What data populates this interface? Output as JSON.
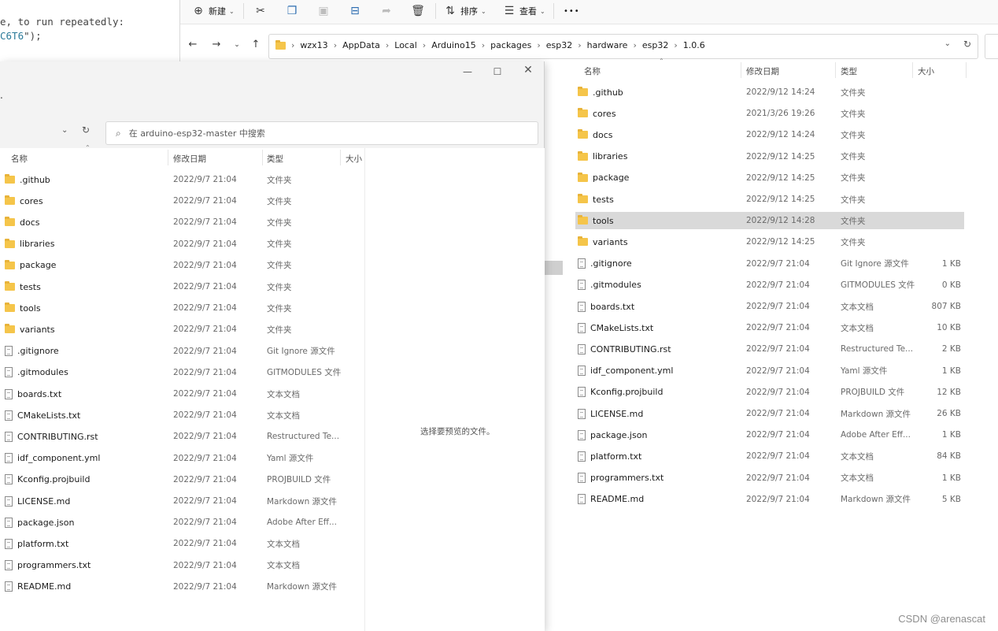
{
  "code_editor": {
    "line1": "e, to run repeatedly:",
    "line2_prefix": "C6T6",
    "line2_suffix": "\");"
  },
  "right_window": {
    "toolbar": {
      "new_label": "新建",
      "sort_label": "排序",
      "view_label": "查看",
      "more_label": "•••"
    },
    "breadcrumb": [
      "wzx13",
      "AppData",
      "Local",
      "Arduino15",
      "packages",
      "esp32",
      "hardware",
      "esp32",
      "1.0.6"
    ],
    "columns": {
      "name": "名称",
      "date": "修改日期",
      "type": "类型",
      "size": "大小"
    },
    "rows": [
      {
        "name": ".github",
        "date": "2022/9/12 14:24",
        "type": "文件夹",
        "size": "",
        "icon": "folder"
      },
      {
        "name": "cores",
        "date": "2021/3/26 19:26",
        "type": "文件夹",
        "size": "",
        "icon": "folder"
      },
      {
        "name": "docs",
        "date": "2022/9/12 14:24",
        "type": "文件夹",
        "size": "",
        "icon": "folder"
      },
      {
        "name": "libraries",
        "date": "2022/9/12 14:25",
        "type": "文件夹",
        "size": "",
        "icon": "folder"
      },
      {
        "name": "package",
        "date": "2022/9/12 14:25",
        "type": "文件夹",
        "size": "",
        "icon": "folder"
      },
      {
        "name": "tests",
        "date": "2022/9/12 14:25",
        "type": "文件夹",
        "size": "",
        "icon": "folder"
      },
      {
        "name": "tools",
        "date": "2022/9/12 14:28",
        "type": "文件夹",
        "size": "",
        "icon": "folder",
        "selected": true
      },
      {
        "name": "variants",
        "date": "2022/9/12 14:25",
        "type": "文件夹",
        "size": "",
        "icon": "folder"
      },
      {
        "name": ".gitignore",
        "date": "2022/9/7 21:04",
        "type": "Git Ignore 源文件",
        "size": "1 KB",
        "icon": "file"
      },
      {
        "name": ".gitmodules",
        "date": "2022/9/7 21:04",
        "type": "GITMODULES 文件",
        "size": "0 KB",
        "icon": "file"
      },
      {
        "name": "boards.txt",
        "date": "2022/9/7 21:04",
        "type": "文本文档",
        "size": "807 KB",
        "icon": "file"
      },
      {
        "name": "CMakeLists.txt",
        "date": "2022/9/7 21:04",
        "type": "文本文档",
        "size": "10 KB",
        "icon": "file"
      },
      {
        "name": "CONTRIBUTING.rst",
        "date": "2022/9/7 21:04",
        "type": "Restructured Te...",
        "size": "2 KB",
        "icon": "file"
      },
      {
        "name": "idf_component.yml",
        "date": "2022/9/7 21:04",
        "type": "Yaml 源文件",
        "size": "1 KB",
        "icon": "file"
      },
      {
        "name": "Kconfig.projbuild",
        "date": "2022/9/7 21:04",
        "type": "PROJBUILD 文件",
        "size": "12 KB",
        "icon": "file"
      },
      {
        "name": "LICENSE.md",
        "date": "2022/9/7 21:04",
        "type": "Markdown 源文件",
        "size": "26 KB",
        "icon": "file"
      },
      {
        "name": "package.json",
        "date": "2022/9/7 21:04",
        "type": "Adobe After Eff...",
        "size": "1 KB",
        "icon": "file"
      },
      {
        "name": "platform.txt",
        "date": "2022/9/7 21:04",
        "type": "文本文档",
        "size": "84 KB",
        "icon": "file"
      },
      {
        "name": "programmers.txt",
        "date": "2022/9/7 21:04",
        "type": "文本文档",
        "size": "1 KB",
        "icon": "file"
      },
      {
        "name": "README.md",
        "date": "2022/9/7 21:04",
        "type": "Markdown 源文件",
        "size": "5 KB",
        "icon": "file"
      }
    ]
  },
  "dialog": {
    "window_dot": ".",
    "search_placeholder": "在 arduino-esp32-master 中搜索",
    "columns": {
      "name": "名称",
      "date": "修改日期",
      "type": "类型",
      "size": "大小"
    },
    "preview_text": "选择要预览的文件。",
    "rows": [
      {
        "name": ".github",
        "date": "2022/9/7 21:04",
        "type": "文件夹",
        "icon": "folder"
      },
      {
        "name": "cores",
        "date": "2022/9/7 21:04",
        "type": "文件夹",
        "icon": "folder"
      },
      {
        "name": "docs",
        "date": "2022/9/7 21:04",
        "type": "文件夹",
        "icon": "folder"
      },
      {
        "name": "libraries",
        "date": "2022/9/7 21:04",
        "type": "文件夹",
        "icon": "folder"
      },
      {
        "name": "package",
        "date": "2022/9/7 21:04",
        "type": "文件夹",
        "icon": "folder"
      },
      {
        "name": "tests",
        "date": "2022/9/7 21:04",
        "type": "文件夹",
        "icon": "folder"
      },
      {
        "name": "tools",
        "date": "2022/9/7 21:04",
        "type": "文件夹",
        "icon": "folder"
      },
      {
        "name": "variants",
        "date": "2022/9/7 21:04",
        "type": "文件夹",
        "icon": "folder"
      },
      {
        "name": ".gitignore",
        "date": "2022/9/7 21:04",
        "type": "Git Ignore 源文件",
        "icon": "file"
      },
      {
        "name": ".gitmodules",
        "date": "2022/9/7 21:04",
        "type": "GITMODULES 文件",
        "icon": "file"
      },
      {
        "name": "boards.txt",
        "date": "2022/9/7 21:04",
        "type": "文本文档",
        "icon": "file"
      },
      {
        "name": "CMakeLists.txt",
        "date": "2022/9/7 21:04",
        "type": "文本文档",
        "icon": "file"
      },
      {
        "name": "CONTRIBUTING.rst",
        "date": "2022/9/7 21:04",
        "type": "Restructured Te...",
        "icon": "file"
      },
      {
        "name": "idf_component.yml",
        "date": "2022/9/7 21:04",
        "type": "Yaml 源文件",
        "icon": "file"
      },
      {
        "name": "Kconfig.projbuild",
        "date": "2022/9/7 21:04",
        "type": "PROJBUILD 文件",
        "icon": "file"
      },
      {
        "name": "LICENSE.md",
        "date": "2022/9/7 21:04",
        "type": "Markdown 源文件",
        "icon": "file"
      },
      {
        "name": "package.json",
        "date": "2022/9/7 21:04",
        "type": "Adobe After Eff...",
        "icon": "file"
      },
      {
        "name": "platform.txt",
        "date": "2022/9/7 21:04",
        "type": "文本文档",
        "icon": "file"
      },
      {
        "name": "programmers.txt",
        "date": "2022/9/7 21:04",
        "type": "文本文档",
        "icon": "file"
      },
      {
        "name": "README.md",
        "date": "2022/9/7 21:04",
        "type": "Markdown 源文件",
        "icon": "file"
      }
    ]
  },
  "watermark": "CSDN @arenascat",
  "colors": {
    "folder": "#f5c54a",
    "selection": "#d9d9d9",
    "toolbar_bg": "#f9f9f9"
  }
}
